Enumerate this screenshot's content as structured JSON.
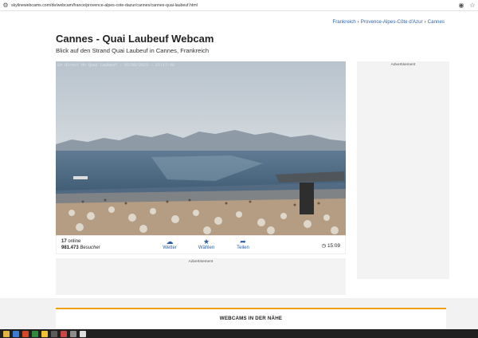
{
  "browser": {
    "url": "skylinewebcams.com/de/webcam/france/provence-alpes-cote-dazur/cannes/cannes-quai-laubeuf.html"
  },
  "breadcrumb": [
    "Frankreich",
    "Provence-Alpes-Côte d'Azur",
    "Cannes"
  ],
  "header": {
    "title": "Cannes - Quai Laubeuf Webcam",
    "subtitle": "Blick auf den Strand Quai Laubeuf in Cannes, Frankreich"
  },
  "webcam": {
    "overlay": "En direct de Quai Laubeuf - 05/08/2023 - 15:17:40"
  },
  "stats": {
    "online_count": "17",
    "online_label": "online",
    "visitors_count": "981.473",
    "visitors_label": "Besucher"
  },
  "controls": {
    "weather_label": "Wetter",
    "favorites_label": "Wählen",
    "share_label": "Teilen",
    "time": "15:09"
  },
  "ads": {
    "label": "Advertisement"
  },
  "nearby": {
    "heading": "WEBCAMS IN DER NÄHE"
  },
  "colors": {
    "link": "#2a63b8",
    "accent": "#f0a20a",
    "sky": "#c3ccd4",
    "sea": "#4f6a84"
  }
}
